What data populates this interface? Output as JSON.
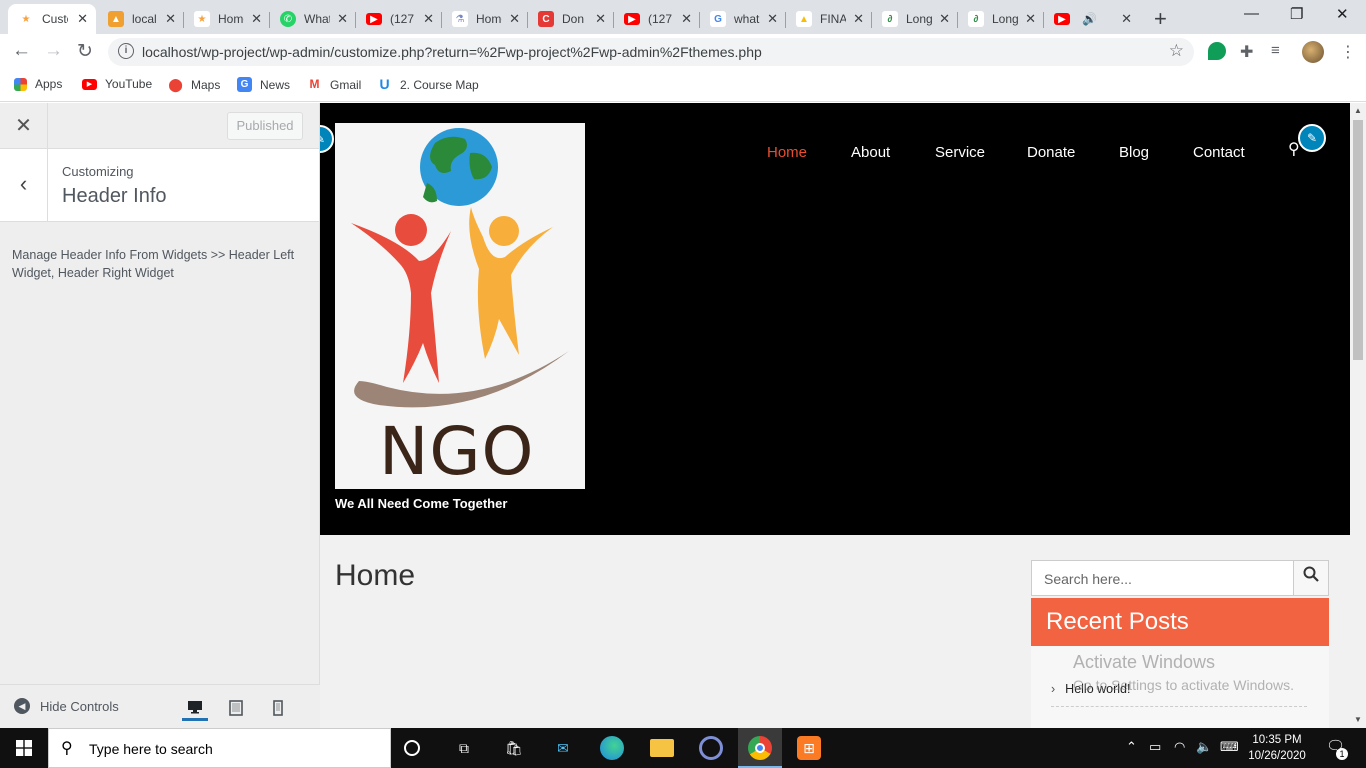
{
  "browser": {
    "tabs": [
      {
        "title": "Custo",
        "favicon": "ngo-icon",
        "color": "#f4a340",
        "active": true
      },
      {
        "title": "local",
        "favicon": "pma-icon",
        "color": "#f0a030"
      },
      {
        "title": "Home",
        "favicon": "ngo-icon",
        "color": "#f4a340"
      },
      {
        "title": "What",
        "favicon": "whatsapp-icon",
        "color": "#25d366"
      },
      {
        "title": "(127",
        "favicon": "youtube-icon",
        "color": "#ff0000"
      },
      {
        "title": "Home",
        "favicon": "flask-icon",
        "color": "#7986cb"
      },
      {
        "title": "Don",
        "favicon": "c-icon",
        "color": "#e53935"
      },
      {
        "title": "(127",
        "favicon": "youtube-icon",
        "color": "#ff0000"
      },
      {
        "title": "what",
        "favicon": "google-icon",
        "color": "#4285f4"
      },
      {
        "title": "FINA",
        "favicon": "drive-icon",
        "color": "#fbbc04"
      },
      {
        "title": "Long",
        "favicon": "gfg-icon",
        "color": "#2f8d46"
      },
      {
        "title": "Long",
        "favicon": "gfg-icon",
        "color": "#2f8d46"
      },
      {
        "title": "",
        "favicon": "youtube-audio-icon",
        "color": "#ff0000"
      }
    ],
    "url": "localhost/wp-project/wp-admin/customize.php?return=%2Fwp-project%2Fwp-admin%2Fthemes.php",
    "bookmarks": [
      {
        "label": "Apps",
        "icon": "apps-grid-icon"
      },
      {
        "label": "YouTube",
        "icon": "youtube-icon"
      },
      {
        "label": "Maps",
        "icon": "maps-pin-icon"
      },
      {
        "label": "News",
        "icon": "news-icon"
      },
      {
        "label": "Gmail",
        "icon": "gmail-icon"
      },
      {
        "label": "2. Course Map",
        "icon": "udemy-icon"
      }
    ]
  },
  "customizer": {
    "publish_label": "Published",
    "breadcrumb": "Customizing",
    "section_title": "Header Info",
    "description": "Manage Header Info From Widgets >> Header Left Widget, Header Right Widget",
    "hide_controls": "Hide Controls"
  },
  "site": {
    "logo_text": "NGO",
    "tagline": "We All Need Come Together",
    "menu": [
      "Home",
      "About",
      "Service",
      "Donate",
      "Blog",
      "Contact"
    ],
    "active_menu": "Home",
    "accent": "#e94e2e",
    "page_title": "Home",
    "search_placeholder": "Search here...",
    "recent_posts_title": "Recent Posts",
    "recent_posts_color": "#f26341",
    "recent_posts": [
      "Hello world!"
    ],
    "watermark_title": "Activate Windows",
    "watermark_sub": "Go to Settings to activate Windows."
  },
  "taskbar": {
    "search_text": "Type here to search",
    "time": "10:35 PM",
    "date": "10/26/2020",
    "notifications": "1"
  }
}
